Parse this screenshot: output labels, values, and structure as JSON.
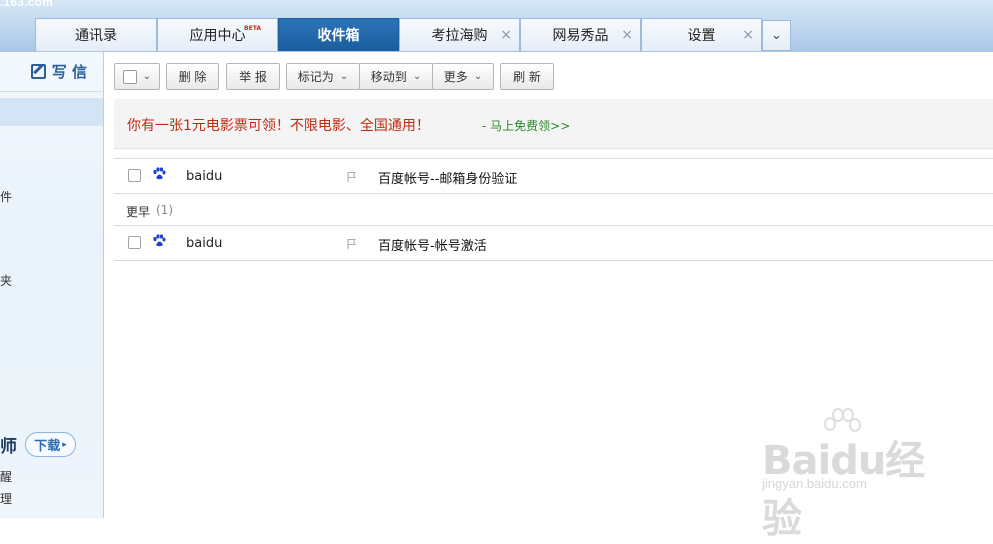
{
  "header": {
    "domain_fragment": ".163.com",
    "tabs": [
      {
        "label": "通讯录",
        "closable": false,
        "active": false,
        "beta": false
      },
      {
        "label": "应用中心",
        "closable": false,
        "active": false,
        "beta": true
      },
      {
        "label": "收件箱",
        "closable": false,
        "active": true,
        "beta": false
      },
      {
        "label": "考拉海购",
        "closable": true,
        "active": false,
        "beta": false
      },
      {
        "label": "网易秀品",
        "closable": true,
        "active": false,
        "beta": false
      },
      {
        "label": "设置",
        "closable": true,
        "active": false,
        "beta": false
      }
    ],
    "beta_badge": "BETA",
    "close_glyph": "×",
    "more_glyph": "⌄"
  },
  "sidebar": {
    "compose_label": "写 信",
    "fragments": [
      "件",
      "夹"
    ],
    "promo_title": "师",
    "download_label": "下载",
    "promo_lines": [
      "醒",
      "理"
    ]
  },
  "toolbar": {
    "delete_label": "删 除",
    "report_label": "举 报",
    "mark_as_label": "标记为",
    "move_to_label": "移动到",
    "more_label": "更多",
    "refresh_label": "刷 新",
    "dropdown_glyph": "⌄"
  },
  "ad": {
    "text": "你有一张1元电影票可领！不限电影、全国通用！",
    "link": "- 马上免费领>>"
  },
  "mail_list": {
    "group_label": "更早",
    "group_count": "(1)",
    "rows": [
      {
        "sender": "baidu",
        "subject": "百度帐号--邮箱身份验证"
      },
      {
        "sender": "baidu",
        "subject": "百度帐号-帐号激活"
      }
    ]
  },
  "watermark": {
    "logo": "Baidu经验",
    "url": "jingyan.baidu.com"
  },
  "colors": {
    "active_tab": "#1a5d9f",
    "ad_text": "#c12a16",
    "ad_link": "#2a8a2a",
    "paw_icon": "#1d3fc9"
  }
}
